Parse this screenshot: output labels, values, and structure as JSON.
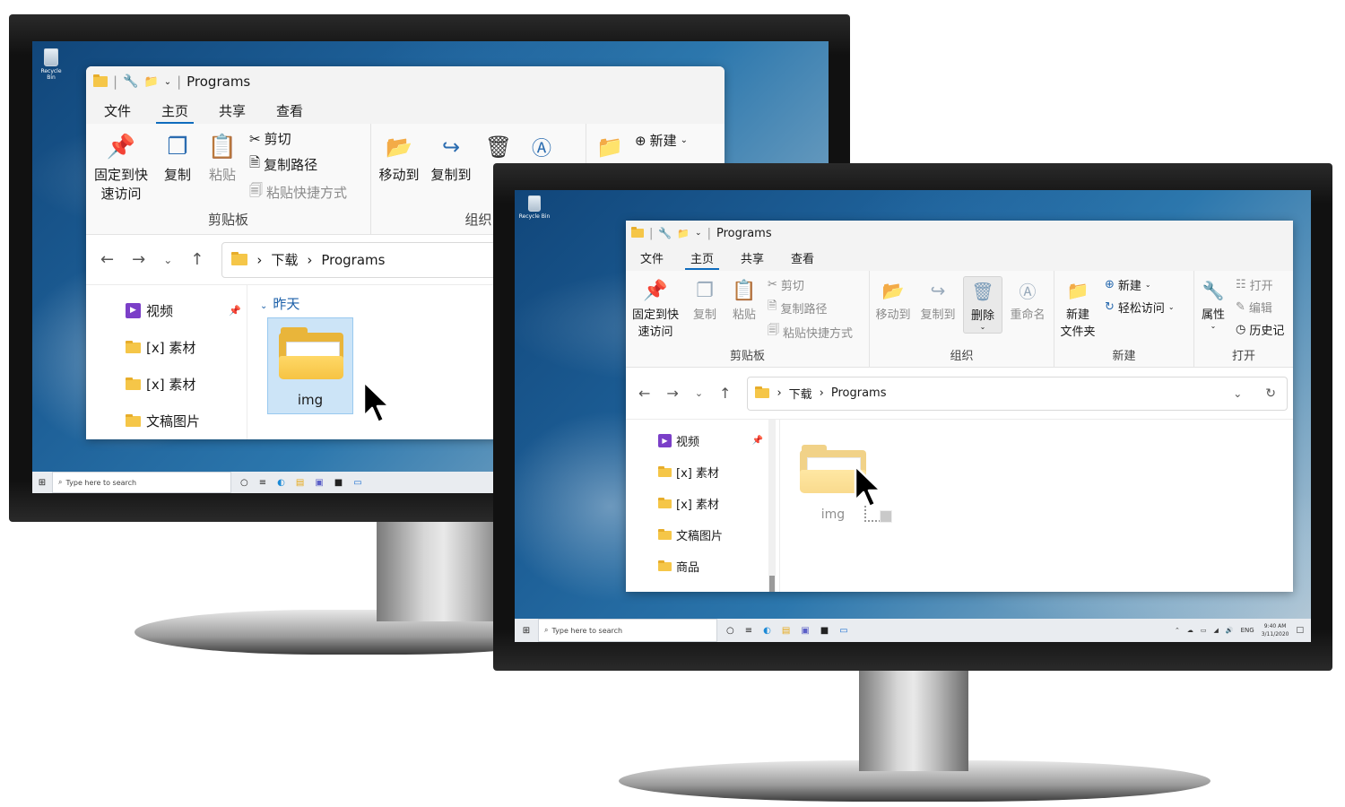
{
  "desktop": {
    "recycle_bin_label": "Recycle Bin",
    "taskbar_search_placeholder": "Type here to search",
    "tray_lang": "ENG",
    "clock_time": "9:40 AM",
    "clock_date": "3/11/2020"
  },
  "explorer": {
    "window_title": "Programs",
    "tabs": [
      "文件",
      "主页",
      "共享",
      "查看"
    ],
    "active_tab": "主页",
    "ribbon": {
      "pin_label_1": "固定到快",
      "pin_label_2": "速访问",
      "copy_label": "复制",
      "paste_label": "粘贴",
      "cut_label": "剪切",
      "copy_path_label": "复制路径",
      "paste_shortcut_label": "粘贴快捷方式",
      "clipboard_group": "剪贴板",
      "move_to_label": "移动到",
      "copy_to_label": "复制到",
      "delete_label": "删除",
      "rename_label": "重命名",
      "organize_group": "组织",
      "new_folder_label_1": "新建",
      "new_folder_label_2": "文件夹",
      "new_item_label": "新建",
      "easy_access_label": "轻松访问",
      "new_group": "新建",
      "properties_label": "属性",
      "open_label": "打开",
      "edit_label": "编辑",
      "history_label": "历史记",
      "open_group": "打开"
    },
    "address": {
      "crumb_1": "下载",
      "crumb_2": "Programs"
    },
    "sidebar_items": [
      "视频",
      "[x] 素材",
      "[x] 素材",
      "文稿图片",
      "商品"
    ],
    "group_header": "昨天",
    "folder_name": "img"
  }
}
